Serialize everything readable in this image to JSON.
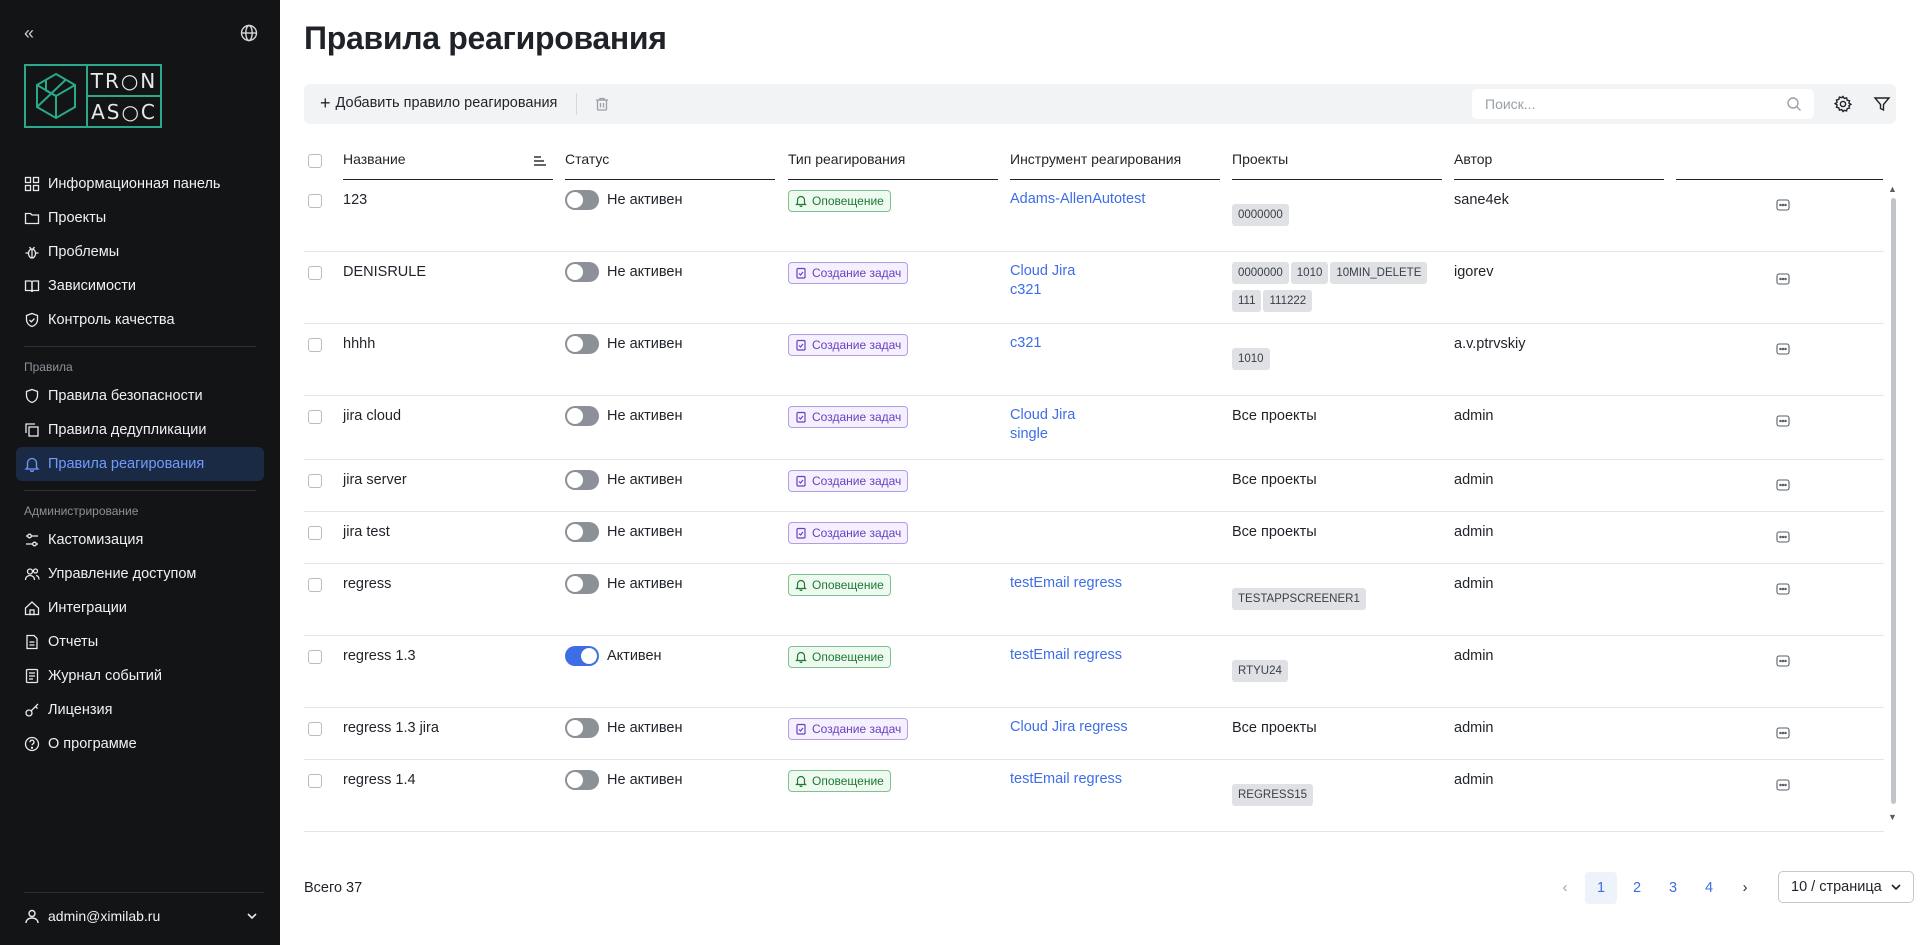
{
  "sidebar": {
    "logo_top": "TR○N",
    "logo_bottom": "AS○C",
    "nav_main": [
      {
        "label": "Информационная панель",
        "icon": "dashboard-icon"
      },
      {
        "label": "Проекты",
        "icon": "folder-icon"
      },
      {
        "label": "Проблемы",
        "icon": "bug-icon"
      },
      {
        "label": "Зависимости",
        "icon": "book-icon"
      },
      {
        "label": "Контроль качества",
        "icon": "shield-check-icon"
      }
    ],
    "group_rules": "Правила",
    "nav_rules": [
      {
        "label": "Правила безопасности",
        "icon": "shield-icon"
      },
      {
        "label": "Правила дедупликации",
        "icon": "copy-icon"
      },
      {
        "label": "Правила реагирования",
        "icon": "bell-icon",
        "active": true
      }
    ],
    "group_admin": "Администрирование",
    "nav_admin": [
      {
        "label": "Кастомизация",
        "icon": "sliders-icon"
      },
      {
        "label": "Управление доступом",
        "icon": "users-icon"
      },
      {
        "label": "Интеграции",
        "icon": "plug-icon"
      },
      {
        "label": "Отчеты",
        "icon": "report-icon"
      },
      {
        "label": "Журнал событий",
        "icon": "log-icon"
      },
      {
        "label": "Лицензия",
        "icon": "key-icon"
      },
      {
        "label": "О программе",
        "icon": "help-icon"
      }
    ],
    "user": "admin@ximilab.ru"
  },
  "page": {
    "title": "Правила реагирования"
  },
  "toolbar": {
    "add_label": "Добавить правило реагирования",
    "search_placeholder": "Поиск..."
  },
  "table": {
    "columns": [
      "Название",
      "Статус",
      "Тип реагирования",
      "Инструмент реагирования",
      "Проекты",
      "Автор"
    ],
    "rows": [
      {
        "name": "123",
        "active": false,
        "status": "Не активен",
        "type": "Оповещение",
        "type_kind": "notify",
        "tools": [
          "Adams-AllenAutotest"
        ],
        "projects_text": "",
        "projects": [
          "0000000"
        ],
        "author": "sane4ek"
      },
      {
        "name": "DENISRULE",
        "active": false,
        "status": "Не активен",
        "type": "Создание задач",
        "type_kind": "task",
        "tools": [
          "Cloud Jira",
          "c321"
        ],
        "projects_text": "",
        "projects": [
          "0000000",
          "1010",
          "10MIN_DELETE",
          "111",
          "111222"
        ],
        "author": "igorev"
      },
      {
        "name": "hhhh",
        "active": false,
        "status": "Не активен",
        "type": "Создание задач",
        "type_kind": "task",
        "tools": [
          "c321"
        ],
        "projects_text": "",
        "projects": [
          "1010"
        ],
        "author": "a.v.ptrvskiy"
      },
      {
        "name": "jira cloud",
        "active": false,
        "status": "Не активен",
        "type": "Создание задач",
        "type_kind": "task",
        "tools": [
          "Cloud Jira",
          "single"
        ],
        "projects_text": "Все проекты",
        "projects": [],
        "author": "admin"
      },
      {
        "name": "jira server",
        "active": false,
        "status": "Не активен",
        "type": "Создание задач",
        "type_kind": "task",
        "tools": [],
        "projects_text": "Все проекты",
        "projects": [],
        "author": "admin"
      },
      {
        "name": "jira test",
        "active": false,
        "status": "Не активен",
        "type": "Создание задач",
        "type_kind": "task",
        "tools": [],
        "projects_text": "Все проекты",
        "projects": [],
        "author": "admin"
      },
      {
        "name": "regress",
        "active": false,
        "status": "Не активен",
        "type": "Оповещение",
        "type_kind": "notify",
        "tools": [
          "testEmail regress"
        ],
        "projects_text": "",
        "projects": [
          "TESTAPPSCREENER1"
        ],
        "author": "admin"
      },
      {
        "name": "regress 1.3",
        "active": true,
        "status": "Активен",
        "type": "Оповещение",
        "type_kind": "notify",
        "tools": [
          "testEmail regress"
        ],
        "projects_text": "",
        "projects": [
          "RTYU24"
        ],
        "author": "admin"
      },
      {
        "name": "regress 1.3 jira",
        "active": false,
        "status": "Не активен",
        "type": "Создание задач",
        "type_kind": "task",
        "tools": [
          "Cloud Jira regress"
        ],
        "projects_text": "Все проекты",
        "projects": [],
        "author": "admin"
      },
      {
        "name": "regress 1.4",
        "active": false,
        "status": "Не активен",
        "type": "Оповещение",
        "type_kind": "notify",
        "tools": [
          "testEmail regress"
        ],
        "projects_text": "",
        "projects": [
          "REGRESS15"
        ],
        "author": "admin"
      }
    ]
  },
  "footer": {
    "total": "Всего 37",
    "pages": [
      "1",
      "2",
      "3",
      "4"
    ],
    "current_page": "1",
    "page_size": "10 / страница"
  },
  "colors": {
    "sidebar_bg": "#121416",
    "accent": "#3d6ee6",
    "logo": "#2aa889",
    "notify_badge": "#1e7a33",
    "task_badge": "#6a3fc2"
  }
}
